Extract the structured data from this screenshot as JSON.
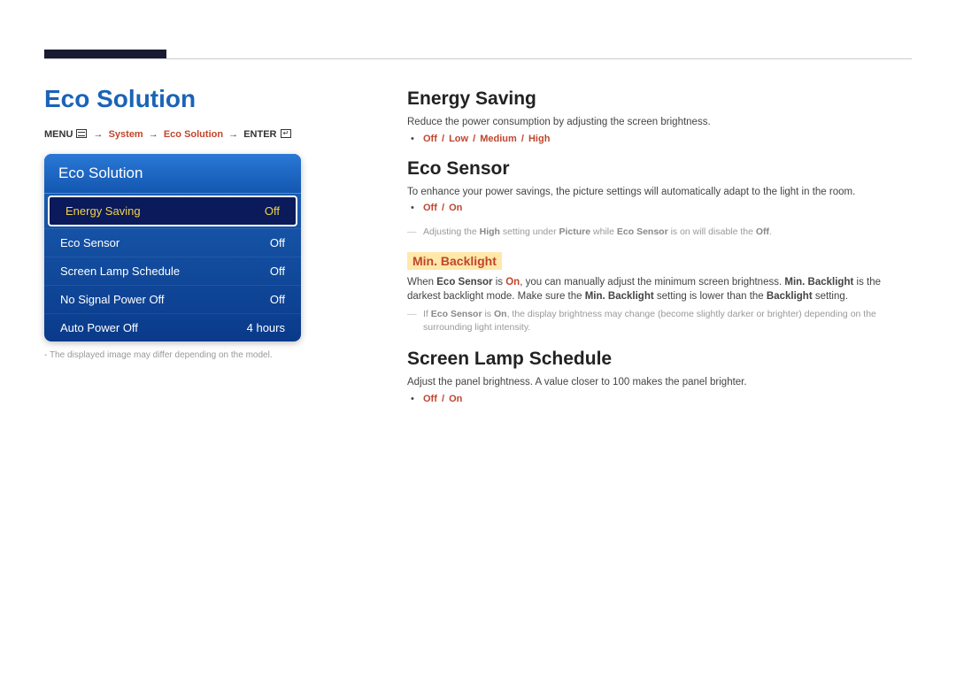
{
  "page": {
    "title": "Eco Solution"
  },
  "breadcrumb": {
    "menu_label": "MENU",
    "system": "System",
    "eco": "Eco Solution",
    "enter_label": "ENTER"
  },
  "menu": {
    "header": "Eco Solution",
    "rows": [
      {
        "label": "Energy Saving",
        "value": "Off",
        "selected": true
      },
      {
        "label": "Eco Sensor",
        "value": "Off",
        "selected": false
      },
      {
        "label": "Screen Lamp Schedule",
        "value": "Off",
        "selected": false
      },
      {
        "label": "No Signal Power Off",
        "value": "Off",
        "selected": false
      },
      {
        "label": "Auto Power Off",
        "value": "4 hours",
        "selected": false
      }
    ],
    "footnote_prefix": "-",
    "footnote": "The displayed image may differ depending on the model."
  },
  "energy_saving": {
    "heading": "Energy Saving",
    "desc": "Reduce the power consumption by adjusting the screen brightness.",
    "options": [
      "Off",
      "Low",
      "Medium",
      "High"
    ]
  },
  "eco_sensor": {
    "heading": "Eco Sensor",
    "desc": "To enhance your power savings, the picture settings will automatically adapt to the light in the room.",
    "options": [
      "Off",
      "On"
    ],
    "note_pre": "Adjusting the ",
    "note_high": "High",
    "note_mid1": " setting under ",
    "note_picture": "Picture",
    "note_mid2": " while ",
    "note_eco": "Eco Sensor",
    "note_mid3": " is on will disable the ",
    "note_off": "Off",
    "note_end": ".",
    "min_backlight": {
      "heading": "Min. Backlight",
      "seg1_a": "When ",
      "seg1_eco": "Eco Sensor",
      "seg1_b": " is ",
      "seg1_on": "On",
      "seg1_c": ", you can manually adjust the minimum screen brightness. ",
      "seg1_mb": "Min. Backlight",
      "seg1_d": " is the darkest backlight mode. Make sure the ",
      "seg1_mb2": "Min. Backlight",
      "seg1_e": " setting is lower than the ",
      "seg1_bl": "Backlight",
      "seg1_f": " setting.",
      "note2_a": "If ",
      "note2_eco": "Eco Sensor",
      "note2_b": " is ",
      "note2_on": "On",
      "note2_c": ", the display brightness may change (become slightly darker or brighter) depending on the surrounding light intensity."
    }
  },
  "screen_lamp": {
    "heading": "Screen Lamp Schedule",
    "desc": "Adjust the panel brightness. A value closer to 100 makes the panel brighter.",
    "options": [
      "Off",
      "On"
    ]
  }
}
